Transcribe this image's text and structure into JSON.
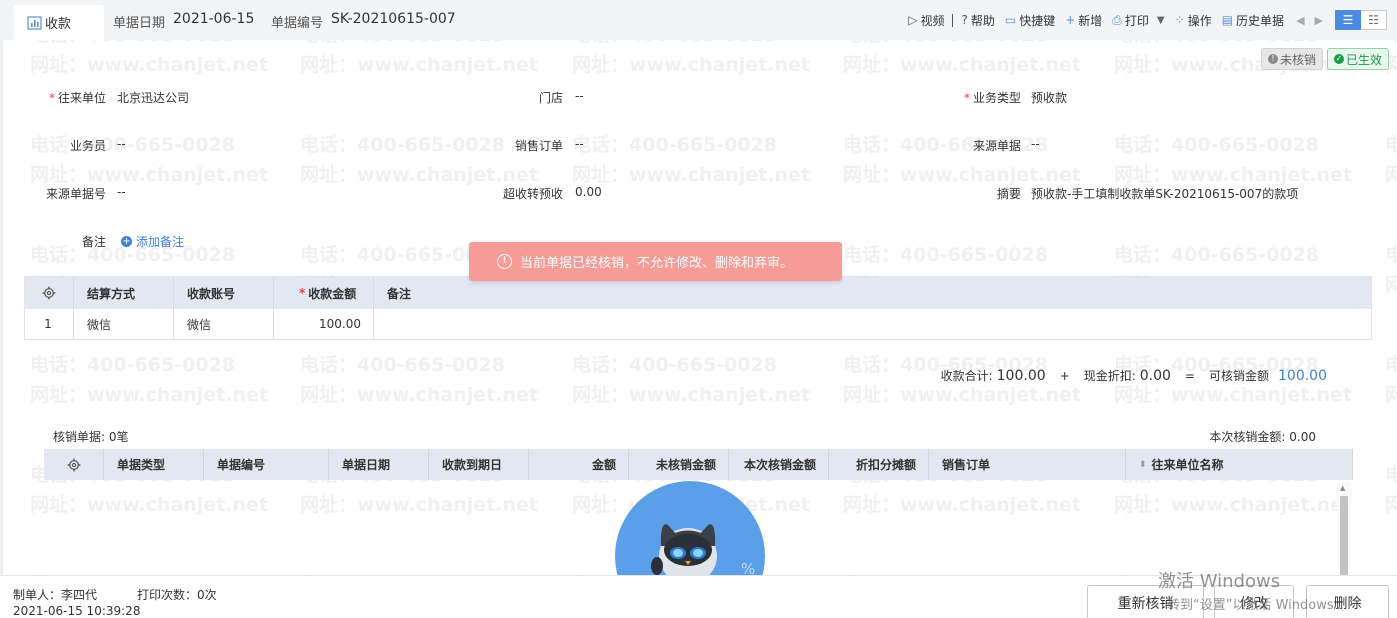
{
  "header": {
    "tab_label": "收款",
    "doc_date_label": "单据日期",
    "doc_date": "2021-06-15",
    "doc_no_label": "单据编号",
    "doc_no": "SK-20210615-007"
  },
  "toolbar": {
    "video": "视频",
    "help": "帮助",
    "shortcut": "快捷键",
    "add": "新增",
    "print": "打印",
    "operate": "操作",
    "history": "历史单据"
  },
  "status": {
    "unverified": "未核销",
    "effective": "已生效"
  },
  "form": {
    "partner_label": "往来单位",
    "partner": "北京迅达公司",
    "store_label": "门店",
    "store": "--",
    "biz_type_label": "业务类型",
    "biz_type": "预收款",
    "salesman_label": "业务员",
    "salesman": "--",
    "sales_order_label": "销售订单",
    "sales_order": "--",
    "source_doc_label": "来源单据",
    "source_doc": "--",
    "source_no_label": "来源单据号",
    "source_no": "--",
    "overpay_label": "超收转预收",
    "overpay": "0.00",
    "summary_label": "摘要",
    "summary": "预收款-手工填制收款单SK-20210615-007的款项",
    "remark_label": "备注",
    "add_remark": "添加备注"
  },
  "toast": {
    "message": "当前单据已经核销，不允许修改、删除和弃审。"
  },
  "settlement_table": {
    "headers": [
      "结算方式",
      "收款账号",
      "收款金额",
      "备注"
    ],
    "rows": [
      {
        "index": "1",
        "method": "微信",
        "account": "微信",
        "amount": "100.00",
        "remark": ""
      }
    ]
  },
  "totals": {
    "receipt_total_label": "收款合计:",
    "receipt_total": "100.00",
    "plus": "+",
    "cash_discount_label": "现金折扣:",
    "cash_discount": "0.00",
    "equals": "=",
    "writeoff_available_label": "可核销金额",
    "writeoff_available": "100.00"
  },
  "writeoff": {
    "count_text": "核销单据: 0笔",
    "amount_text": "本次核销金额: 0.00",
    "headers": [
      "单据类型",
      "单据编号",
      "单据日期",
      "收款到期日",
      "金额",
      "未核销金额",
      "本次核销金额",
      "折扣分摊额",
      "销售订单",
      "往来单位名称"
    ]
  },
  "footer": {
    "creator": "制单人：李四代",
    "print_count": "打印次数：0次",
    "created_time": "2021-06-15 10:39:28",
    "re_writeoff": "重新核销",
    "modify": "修改",
    "delete": "删除"
  },
  "watermark": {
    "phone": "电话：400-665-0028",
    "site": "网址：www.chanjet.net"
  },
  "os_overlay": {
    "activate": "激活 Windows",
    "activate_sub": "转到“设置”以激活 Windows"
  },
  "colors": {
    "accent": "#3f82d6",
    "toast_bg": "#f79b97",
    "table_header": "#e3e7f1",
    "effective_green": "#1a9a4a"
  }
}
